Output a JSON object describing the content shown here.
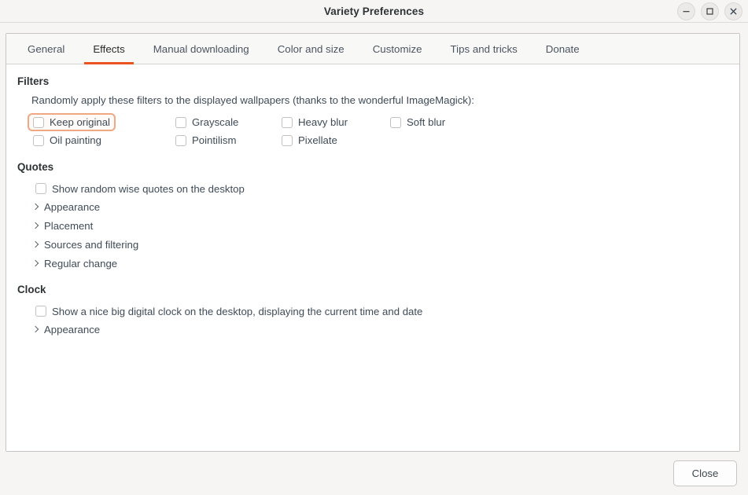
{
  "window": {
    "title": "Variety Preferences",
    "controls": [
      {
        "name": "minimize-button",
        "glyph": "minimize"
      },
      {
        "name": "maximize-button",
        "glyph": "maximize"
      },
      {
        "name": "close-button",
        "glyph": "close"
      }
    ]
  },
  "tabs": [
    {
      "label": "General",
      "active": false
    },
    {
      "label": "Effects",
      "active": true
    },
    {
      "label": "Manual downloading",
      "active": false
    },
    {
      "label": "Color and size",
      "active": false
    },
    {
      "label": "Customize",
      "active": false
    },
    {
      "label": "Tips and tricks",
      "active": false
    },
    {
      "label": "Donate",
      "active": false
    }
  ],
  "colors": {
    "accent": "#e95420",
    "focus_ring": "#f0a882",
    "titlebar_bg": "#f6f5f4",
    "page_bg": "#ffffff"
  },
  "filters": {
    "title": "Filters",
    "description": "Randomly apply these filters to the displayed wallpapers (thanks to the wonderful ImageMagick):",
    "items": [
      {
        "label": "Keep original",
        "checked": false,
        "focused": true,
        "col": 0,
        "row": 0
      },
      {
        "label": "Oil painting",
        "checked": false,
        "focused": false,
        "col": 0,
        "row": 1
      },
      {
        "label": "Grayscale",
        "checked": false,
        "focused": false,
        "col": 1,
        "row": 0
      },
      {
        "label": "Pointilism",
        "checked": false,
        "focused": false,
        "col": 1,
        "row": 1
      },
      {
        "label": "Heavy blur",
        "checked": false,
        "focused": false,
        "col": 2,
        "row": 0
      },
      {
        "label": "Pixellate",
        "checked": false,
        "focused": false,
        "col": 2,
        "row": 1
      },
      {
        "label": "Soft blur",
        "checked": false,
        "focused": false,
        "col": 3,
        "row": 0
      }
    ]
  },
  "quotes": {
    "title": "Quotes",
    "checkbox": {
      "label": "Show random wise quotes on the desktop",
      "checked": false
    },
    "expanders": [
      {
        "label": "Appearance"
      },
      {
        "label": "Placement"
      },
      {
        "label": "Sources and filtering"
      },
      {
        "label": "Regular change"
      }
    ]
  },
  "clock": {
    "title": "Clock",
    "checkbox": {
      "label": "Show a nice big digital clock on the desktop, displaying the current time and date",
      "checked": false
    },
    "expanders": [
      {
        "label": "Appearance"
      }
    ]
  },
  "actionbar": {
    "close_label": "Close"
  }
}
